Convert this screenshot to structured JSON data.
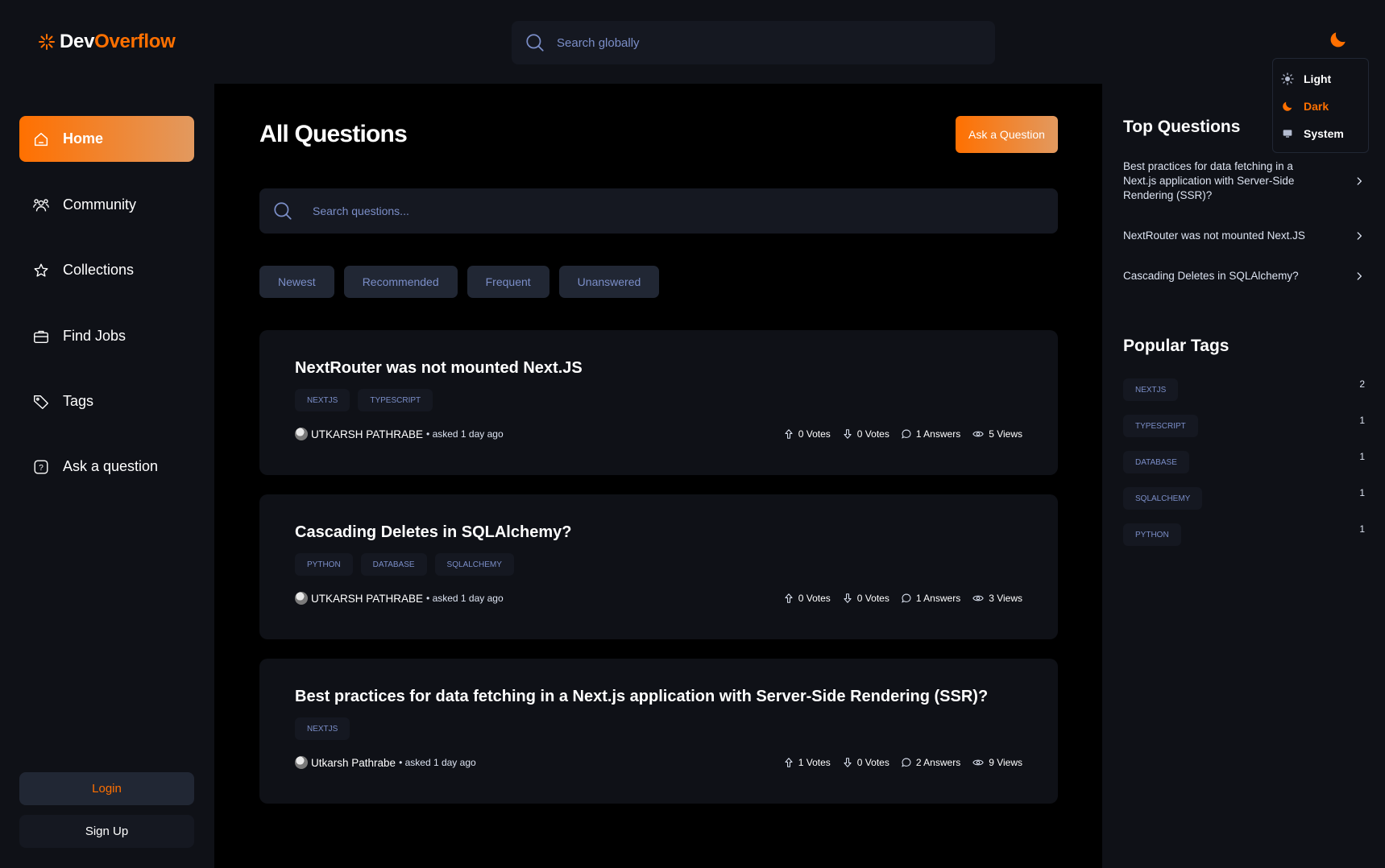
{
  "brand": {
    "part1": "Dev",
    "part2": "Overflow"
  },
  "header": {
    "search_placeholder": "Search globally"
  },
  "theme_menu": {
    "options": [
      {
        "label": "Light",
        "icon": "sun-icon",
        "active": false
      },
      {
        "label": "Dark",
        "icon": "moon-icon",
        "active": true
      },
      {
        "label": "System",
        "icon": "monitor-icon",
        "active": false
      }
    ]
  },
  "sidebar": {
    "items": [
      {
        "label": "Home",
        "icon": "home-icon",
        "active": true
      },
      {
        "label": "Community",
        "icon": "community-icon",
        "active": false
      },
      {
        "label": "Collections",
        "icon": "star-icon",
        "active": false
      },
      {
        "label": "Find Jobs",
        "icon": "briefcase-icon",
        "active": false
      },
      {
        "label": "Tags",
        "icon": "tag-icon",
        "active": false
      },
      {
        "label": "Ask a question",
        "icon": "question-icon",
        "active": false
      }
    ],
    "login_label": "Login",
    "signup_label": "Sign Up"
  },
  "main": {
    "title": "All Questions",
    "ask_button": "Ask a Question",
    "search_placeholder": "Search questions...",
    "filters": [
      "Newest",
      "Recommended",
      "Frequent",
      "Unanswered"
    ],
    "questions": [
      {
        "title": "NextRouter was not mounted Next.JS",
        "tags": [
          "NEXTJS",
          "TYPESCRIPT"
        ],
        "author": "UTKARSH PATHRABE",
        "asked": "• asked 1 day ago",
        "upvotes": "0 Votes",
        "downvotes": "0 Votes",
        "answers": "1 Answers",
        "views": "5 Views"
      },
      {
        "title": "Cascading Deletes in SQLAlchemy?",
        "tags": [
          "PYTHON",
          "DATABASE",
          "SQLALCHEMY"
        ],
        "author": "UTKARSH PATHRABE",
        "asked": "• asked 1 day ago",
        "upvotes": "0 Votes",
        "downvotes": "0 Votes",
        "answers": "1 Answers",
        "views": "3 Views"
      },
      {
        "title": "Best practices for data fetching in a Next.js application with Server-Side Rendering (SSR)?",
        "tags": [
          "NEXTJS"
        ],
        "author": "Utkarsh Pathrabe",
        "asked": "• asked 1 day ago",
        "upvotes": "1 Votes",
        "downvotes": "0 Votes",
        "answers": "2 Answers",
        "views": "9 Views"
      }
    ]
  },
  "rightbar": {
    "top_questions_title": "Top Questions",
    "top_questions": [
      "Best practices for data fetching in a Next.js application with Server-Side Rendering (SSR)?",
      "NextRouter was not mounted Next.JS",
      "Cascading Deletes in SQLAlchemy?"
    ],
    "popular_tags_title": "Popular Tags",
    "popular_tags": [
      {
        "name": "NEXTJS",
        "count": "2"
      },
      {
        "name": "TYPESCRIPT",
        "count": "1"
      },
      {
        "name": "DATABASE",
        "count": "1"
      },
      {
        "name": "SQLALCHEMY",
        "count": "1"
      },
      {
        "name": "PYTHON",
        "count": "1"
      }
    ]
  },
  "colors": {
    "accent": "#ff7000",
    "accent_light": "#e2995f",
    "muted_text": "#7b8ec8",
    "card": "#0f1117",
    "chip": "#212734"
  }
}
